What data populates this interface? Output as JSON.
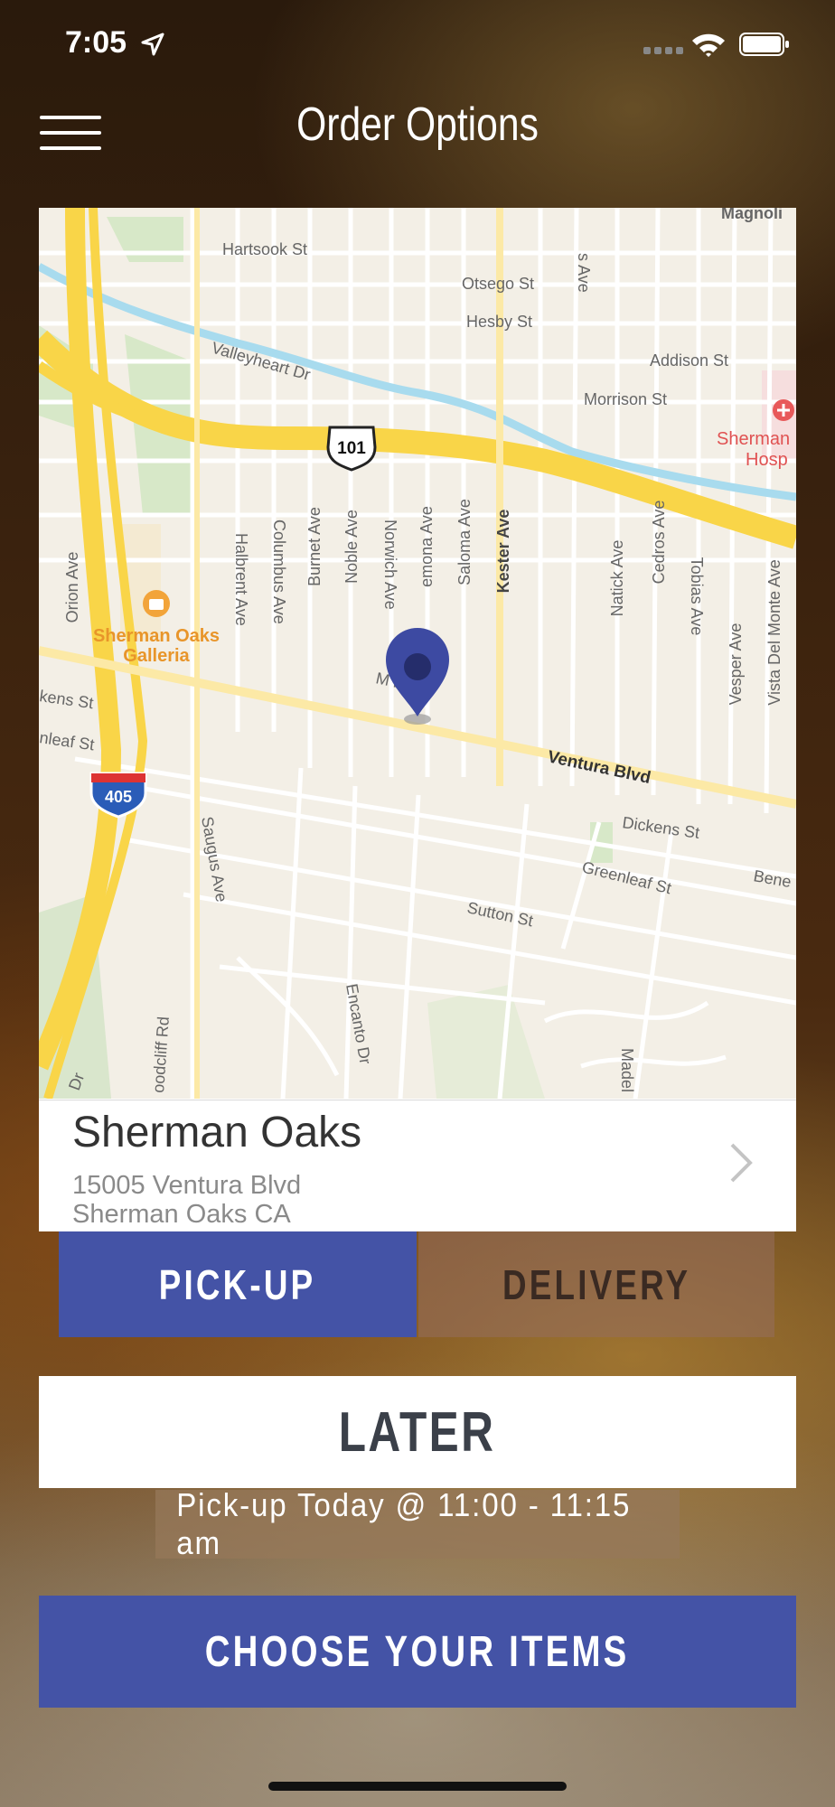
{
  "status_bar": {
    "time": "7:05"
  },
  "header": {
    "title": "Order Options"
  },
  "map": {
    "streets": {
      "hartsook": "Hartsook St",
      "otsego": "Otsego St",
      "hesby": "Hesby St",
      "addison": "Addison St",
      "morrison": "Morrison St",
      "valleyheart": "Valleyheart Dr",
      "magnolia": "Magnoli",
      "hospital1": "Sherman",
      "hospital2": "Hosp",
      "ave_top": "s Ave",
      "halbrent": "Halbrent Ave",
      "columbus": "Columbus Ave",
      "burnet": "Burnet Ave",
      "noble": "Noble Ave",
      "norwich": "Norwich Ave",
      "lemona": "emona Ave",
      "saloma": "Saloma Ave",
      "kester": "Kester Ave",
      "natick": "Natick Ave",
      "cedros": "Cedros Ave",
      "tobias": "Tobias Ave",
      "vesper": "Vesper Ave",
      "vista": "Vista Del Monte Ave",
      "orion": "Orion Ave",
      "galleria1": "Sherman Oaks",
      "galleria2": "Galleria",
      "kens": "kens St",
      "leaf": "nleaf St",
      "moorpark": "M     rk St",
      "ventura": "Ventura Blvd",
      "dickens": "Dickens St",
      "greenleaf": "Greenleaf St",
      "bene": "Bene",
      "sutton": "Sutton St",
      "saugus": "Saugus Ave",
      "encanto": "Encanto Dr",
      "woodcliff": "oodcliff Rd",
      "dr": "Dr",
      "madel": "Madel"
    },
    "shields": {
      "us101": "101",
      "i405": "405"
    }
  },
  "store": {
    "name": "Sherman Oaks",
    "address_line1": "15005 Ventura Blvd",
    "address_line2": "Sherman Oaks CA"
  },
  "tabs": {
    "pickup": "PICK-UP",
    "delivery": "DELIVERY",
    "selected": "pickup"
  },
  "timing": {
    "later_label": "LATER",
    "pickup_time": "Pick-up Today @ 11:00 - 11:15 am"
  },
  "cta": {
    "choose_items": "CHOOSE YOUR ITEMS"
  },
  "colors": {
    "accent": "#4453a6",
    "pin": "#3d4aa2",
    "freeway": "#f9d548",
    "river": "#a8dbee",
    "map_bg": "#f3efe6"
  },
  "icons": {
    "menu": "hamburger-icon",
    "location": "location-arrow-icon",
    "wifi": "wifi-icon",
    "battery": "battery-icon",
    "pin": "map-pin-icon",
    "chevron": "chevron-right-icon",
    "hospital": "hospital-icon",
    "shopping": "shopping-bag-icon"
  }
}
